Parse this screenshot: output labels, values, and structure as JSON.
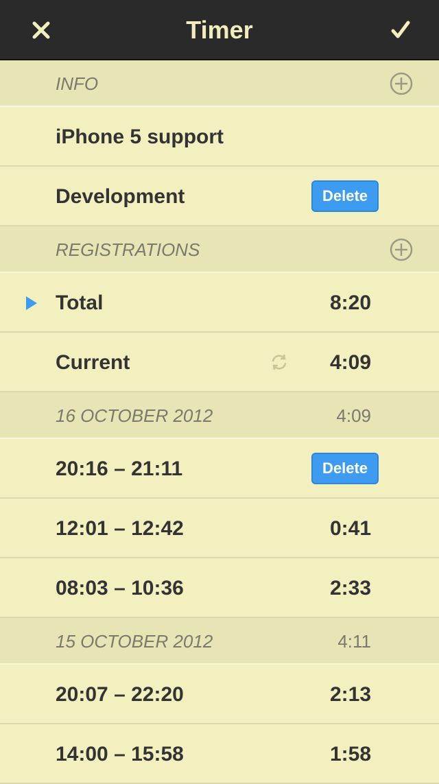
{
  "navbar": {
    "title": "Timer",
    "close_icon": "close-icon",
    "confirm_icon": "checkmark-icon"
  },
  "info": {
    "header": "INFO",
    "rows": [
      {
        "label": "iPhone 5 support"
      },
      {
        "label": "Development",
        "delete_label": "Delete"
      }
    ]
  },
  "registrations": {
    "header": "REGISTRATIONS",
    "total": {
      "label": "Total",
      "value": "8:20"
    },
    "current": {
      "label": "Current",
      "value": "4:09"
    }
  },
  "days": [
    {
      "date": "16 OCTOBER 2012",
      "total": "4:09",
      "entries": [
        {
          "range": "20:16 – 21:11",
          "delete_label": "Delete"
        },
        {
          "range": "12:01 – 12:42",
          "duration": "0:41"
        },
        {
          "range": "08:03 – 10:36",
          "duration": "2:33"
        }
      ]
    },
    {
      "date": "15 OCTOBER 2012",
      "total": "4:11",
      "entries": [
        {
          "range": "20:07 – 22:20",
          "duration": "2:13"
        },
        {
          "range": "14:00 – 15:58",
          "duration": "1:58"
        }
      ]
    }
  ],
  "colors": {
    "navbar": "#2a2a2a",
    "background": "#f3f0bf",
    "section": "#e7e5b5",
    "accent": "#3d9cf0"
  }
}
